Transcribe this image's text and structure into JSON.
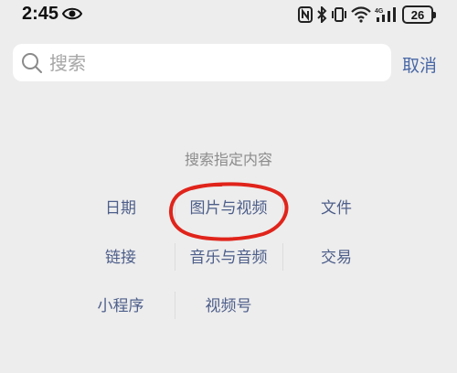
{
  "status_bar": {
    "time": "2:45",
    "battery": "26",
    "icons": [
      "eye-icon",
      "nfc-icon",
      "bluetooth-icon",
      "vibrate-icon",
      "wifi-icon",
      "cellular-4g-icon",
      "battery-icon"
    ]
  },
  "search": {
    "placeholder": "搜索",
    "value": "",
    "cancel_label": "取消"
  },
  "section": {
    "title": "搜索指定内容",
    "categories": [
      {
        "label": "日期"
      },
      {
        "label": "图片与视频"
      },
      {
        "label": "文件"
      },
      {
        "label": "链接"
      },
      {
        "label": "音乐与音频"
      },
      {
        "label": "交易"
      },
      {
        "label": "小程序"
      },
      {
        "label": "视频号"
      }
    ]
  },
  "colors": {
    "background": "#ededed",
    "link_blue": "#4a68a6",
    "category_text": "#4d5e8a",
    "annotation_red": "#e0241b"
  }
}
